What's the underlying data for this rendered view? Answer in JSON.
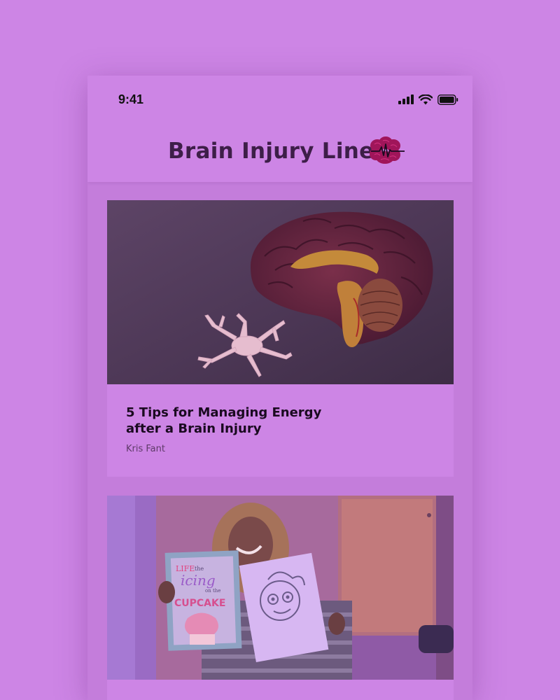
{
  "status_bar": {
    "time": "9:41",
    "signal_icon": "cellular-signal-icon",
    "wifi_icon": "wifi-icon",
    "battery_icon": "battery-icon"
  },
  "header": {
    "title": "Brain Injury Line",
    "logo_icon": "brain-heartbeat-icon"
  },
  "articles": [
    {
      "image": "brain-model-photo",
      "title": "5 Tips for Managing Energy after a Brain Injury",
      "author": "Kris Fant"
    },
    {
      "image": "person-holding-drawings-photo",
      "drawing_text": [
        "LIFE",
        "the",
        "icing",
        "on the",
        "CUPCAKE"
      ]
    }
  ],
  "colors": {
    "background": "#cd85e5",
    "title_text": "#3d1e48",
    "logo": "#a0155a"
  }
}
